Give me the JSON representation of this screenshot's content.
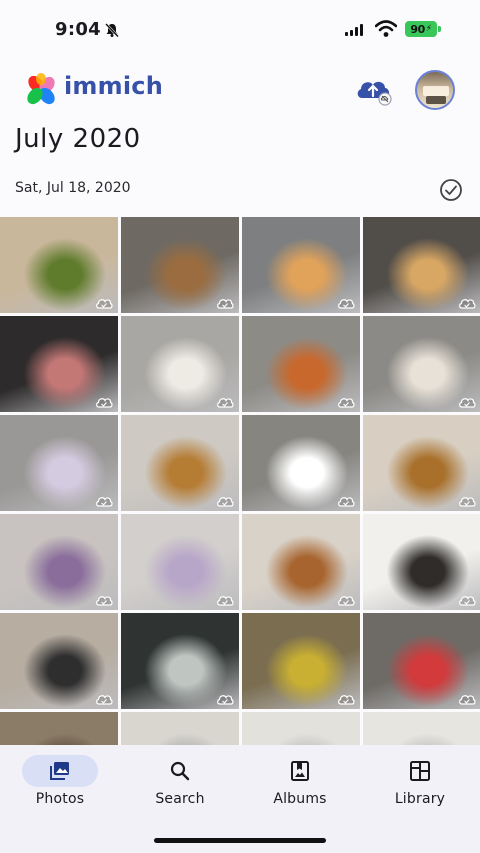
{
  "status_bar": {
    "time": "9:04",
    "battery": "90"
  },
  "header": {
    "app_name": "immich",
    "icons": {
      "logo": "immich-logo-icon",
      "upload": "cloud-upload-icon"
    }
  },
  "timeline": {
    "month_title": "July 2020",
    "day_label": "Sat, Jul 18, 2020"
  },
  "photos": [
    {
      "name": "banh-mi-on-board-with-tea",
      "bg": "#c9b79b",
      "accent": "#5f7b2c"
    },
    {
      "name": "banh-mi-outdoor-table",
      "bg": "#6e6a63",
      "accent": "#9b6c3f"
    },
    {
      "name": "thai-tea-with-sandwich",
      "bg": "#7d7f80",
      "accent": "#e1a25a"
    },
    {
      "name": "bread-rolls-on-tray",
      "bg": "#514d49",
      "accent": "#d8a764"
    },
    {
      "name": "meat-slicing-prep",
      "bg": "#2d2b2b",
      "accent": "#c47876"
    },
    {
      "name": "chef-with-grinder",
      "bg": "#a9a7a3",
      "accent": "#eeeae4"
    },
    {
      "name": "iced-tea-and-sandwich",
      "bg": "#8d8b86",
      "accent": "#c9682c"
    },
    {
      "name": "iced-coffee-on-table",
      "bg": "#8c8a86",
      "accent": "#e8e1d7"
    },
    {
      "name": "taro-milk-tea",
      "bg": "#9a9896",
      "accent": "#d5cbe0"
    },
    {
      "name": "sandwich-closeup",
      "bg": "#cec9c2",
      "accent": "#b57c34"
    },
    {
      "name": "abstract-gradient",
      "bg": "#868580",
      "accent": "#ffffff"
    },
    {
      "name": "sandwich-with-drink",
      "bg": "#d8cfc2",
      "accent": "#a8702b"
    },
    {
      "name": "taro-tea-lemon",
      "bg": "#c8c3c0",
      "accent": "#8a6d9b"
    },
    {
      "name": "purple-tea-plain",
      "bg": "#d2cfcc",
      "accent": "#b8a6c9"
    },
    {
      "name": "sandwich-and-taro-tea",
      "bg": "#d9d2c8",
      "accent": "#a7642e"
    },
    {
      "name": "handwritten-menu-wall",
      "bg": "#f1f0ec",
      "accent": "#2f2c2a"
    },
    {
      "name": "staff-at-counter",
      "bg": "#b7ada1",
      "accent": "#2e2e2e"
    },
    {
      "name": "chalkboard-menu",
      "bg": "#2f3432",
      "accent": "#bfc6c2"
    },
    {
      "name": "snack-shelves",
      "bg": "#7a6d50",
      "accent": "#c9b032"
    },
    {
      "name": "colorful-drinks",
      "bg": "#6e6b66",
      "accent": "#d23a3c"
    },
    {
      "name": "partial-1",
      "bg": "#8b7c68",
      "accent": "#5a4a38"
    },
    {
      "name": "partial-2",
      "bg": "#d9d6d0",
      "accent": "#aaa"
    },
    {
      "name": "partial-3",
      "bg": "#e3e1dc",
      "accent": "#bbb"
    },
    {
      "name": "partial-4",
      "bg": "#e7e5e0",
      "accent": "#bbb"
    }
  ],
  "nav": [
    {
      "label": "Photos",
      "icon": "photos-icon",
      "active": true
    },
    {
      "label": "Search",
      "icon": "search-icon",
      "active": false
    },
    {
      "label": "Albums",
      "icon": "albums-icon",
      "active": false
    },
    {
      "label": "Library",
      "icon": "library-icon",
      "active": false
    }
  ],
  "colors": {
    "accent": "#3751a8",
    "nav_active_pill": "#d9dff5",
    "battery": "#39c759"
  }
}
